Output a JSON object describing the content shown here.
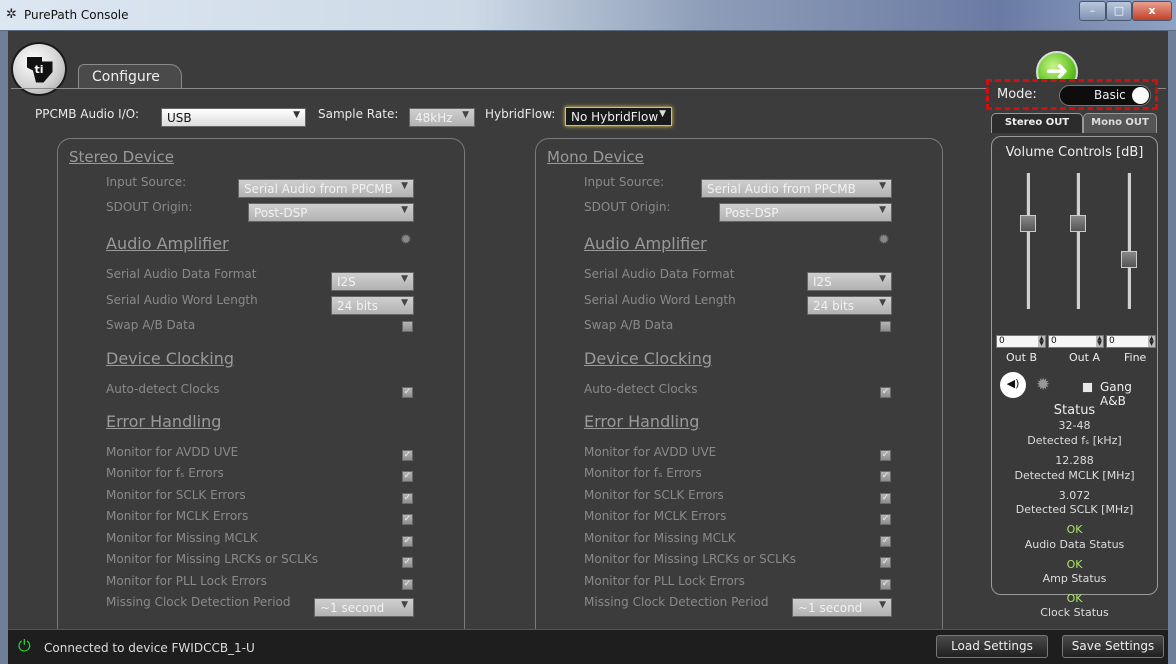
{
  "window": {
    "title": "PurePath Console",
    "min": "–",
    "max": "□",
    "close": "x"
  },
  "tab_configure": "Configure",
  "top": {
    "audio_io_label": "PPCMB Audio I/O:",
    "audio_io_value": "USB",
    "sample_rate_label": "Sample Rate:",
    "sample_rate_value": "48kHz",
    "hybrid_label": "HybridFlow:",
    "hybrid_value": "No HybridFlow"
  },
  "stereo": {
    "title": "Stereo Device",
    "input_source_label": "Input Source:",
    "input_source_value": "Serial Audio from PPCMB",
    "sdout_label": "SDOUT Origin:",
    "sdout_value": "Post-DSP",
    "amp_title": "Audio Amplifier",
    "data_format_label": "Serial Audio Data Format",
    "data_format_value": "I2S",
    "word_length_label": "Serial Audio Word Length",
    "word_length_value": "24 bits",
    "swap_label": "Swap A/B Data",
    "clocking_title": "Device Clocking",
    "autodetect_label": "Auto-detect Clocks",
    "error_title": "Error Handling",
    "monitors": [
      "Monitor for AVDD UVE",
      "Monitor for fₛ Errors",
      "Monitor for SCLK Errors",
      "Monitor for MCLK Errors",
      "Monitor for Missing MCLK",
      "Monitor for Missing LRCKs or SCLKs",
      "Monitor for PLL Lock Errors"
    ],
    "missing_period_label": "Missing Clock Detection Period",
    "missing_period_value": "~1 second"
  },
  "mono": {
    "title": "Mono Device",
    "input_source_label": "Input Source:",
    "input_source_value": "Serial Audio from PPCMB",
    "sdout_label": "SDOUT Origin:",
    "sdout_value": "Post-DSP",
    "amp_title": "Audio Amplifier",
    "data_format_label": "Serial Audio Data Format",
    "data_format_value": "I2S",
    "word_length_label": "Serial Audio Word Length",
    "word_length_value": "24 bits",
    "swap_label": "Swap A/B Data",
    "clocking_title": "Device Clocking",
    "autodetect_label": "Auto-detect Clocks",
    "error_title": "Error Handling",
    "monitors": [
      "Monitor for AVDD UVE",
      "Monitor for fₛ Errors",
      "Monitor for SCLK Errors",
      "Monitor for MCLK Errors",
      "Monitor for Missing MCLK",
      "Monitor for Missing LRCKs or SCLKs",
      "Monitor for PLL Lock Errors"
    ],
    "missing_period_label": "Missing Clock Detection Period",
    "missing_period_value": "~1 second"
  },
  "mode": {
    "label": "Mode:",
    "value": "Basic"
  },
  "out_tabs": {
    "stereo": "Stereo OUT",
    "mono": "Mono OUT"
  },
  "volume": {
    "title": "Volume Controls [dB]",
    "out_b_value": "0",
    "out_a_value": "0",
    "fine_value": "0",
    "out_b_label": "Out B",
    "out_a_label": "Out A",
    "fine_label": "Fine",
    "gang_label": "Gang A&B"
  },
  "status": {
    "title": "Status",
    "fs_value": "32-48",
    "fs_label": "Detected fₛ [kHz]",
    "mclk_value": "12.288",
    "mclk_label": "Detected MCLK [MHz]",
    "sclk_value": "3.072",
    "sclk_label": "Detected SCLK [MHz]",
    "audio_value": "OK",
    "audio_label": "Audio Data Status",
    "amp_value": "OK",
    "amp_label": "Amp Status",
    "clock_value": "OK",
    "clock_label": "Clock Status"
  },
  "statusbar": {
    "connection": "Connected to device FWIDCCB_1-U",
    "load": "Load Settings",
    "save": "Save Settings"
  },
  "colors": {
    "ok": "#a9e46a",
    "connected": "#2fd23a",
    "mode_highlight": "#d01010",
    "hybrid_highlight": "#d8c450"
  }
}
